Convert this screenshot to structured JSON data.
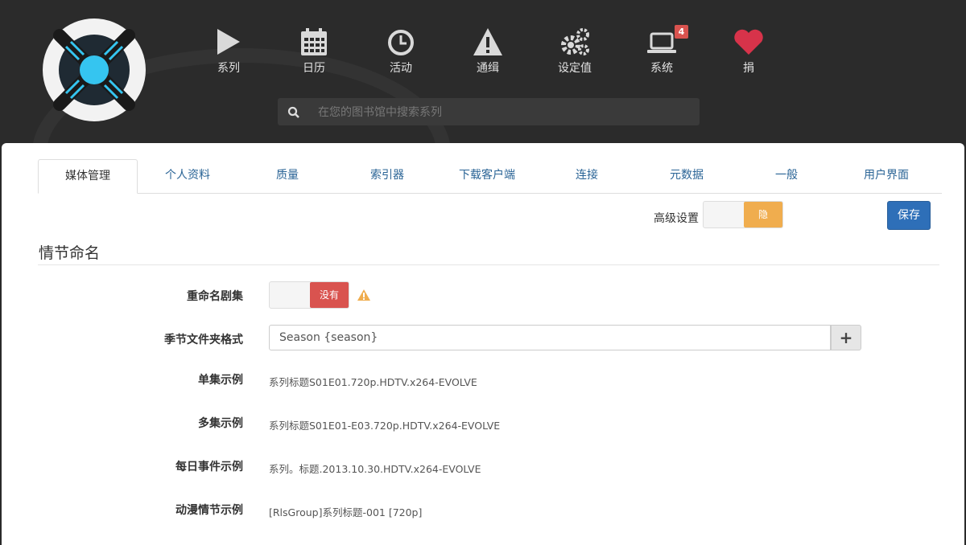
{
  "nav": {
    "items": [
      {
        "label": "系列",
        "icon": "play-icon"
      },
      {
        "label": "日历",
        "icon": "calendar-icon"
      },
      {
        "label": "活动",
        "icon": "clock-icon"
      },
      {
        "label": "通缉",
        "icon": "warning-icon"
      },
      {
        "label": "设定值",
        "icon": "gears-icon"
      },
      {
        "label": "系统",
        "icon": "laptop-icon",
        "badge": "4"
      },
      {
        "label": "捐",
        "icon": "heart-icon"
      }
    ]
  },
  "search": {
    "placeholder": "在您的图书馆中搜索系列"
  },
  "tabs": [
    "媒体管理",
    "个人资料",
    "质量",
    "索引器",
    "下载客户端",
    "连接",
    "元数据",
    "一般",
    "用户界面"
  ],
  "advanced": {
    "label": "高级设置",
    "state": "隐"
  },
  "save_label": "保存",
  "section": {
    "title": "情节命名"
  },
  "rename": {
    "label": "重命名剧集",
    "state": "没有"
  },
  "season_folder": {
    "label": "季节文件夹格式",
    "value": "Season {season}"
  },
  "examples": [
    {
      "label": "单集示例",
      "value": "系列标题S01E01.720p.HDTV.x264-EVOLVE"
    },
    {
      "label": "多集示例",
      "value": "系列标题S01E01-E03.720p.HDTV.x264-EVOLVE"
    },
    {
      "label": "每日事件示例",
      "value": "系列。标题.2013.10.30.HDTV.x264-EVOLVE"
    },
    {
      "label": "动漫情节示例",
      "value": "[RlsGroup]系列标题-001 [720p]"
    }
  ],
  "colors": {
    "header_bg": "#2b2b2b",
    "accent": "#35c5f0",
    "primary": "#2e6fb8",
    "danger": "#d9534f",
    "warning": "#f0ad4e",
    "heart": "#d7334a"
  }
}
